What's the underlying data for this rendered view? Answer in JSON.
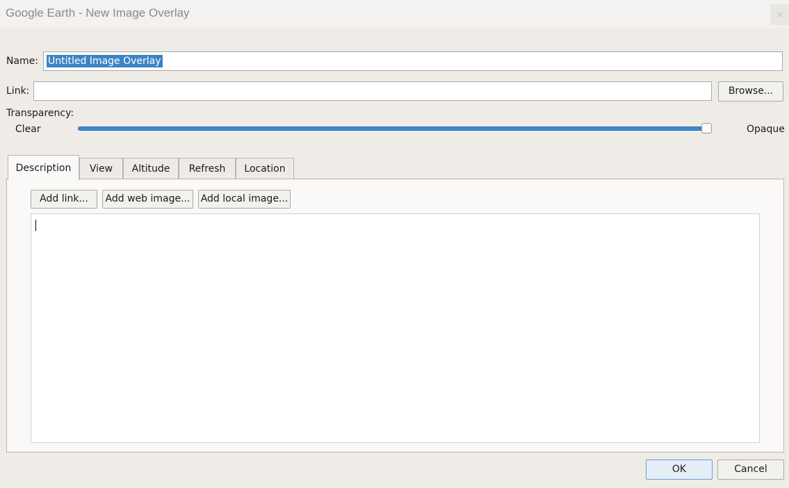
{
  "window": {
    "title": "Google Earth - New Image Overlay",
    "close_glyph": "×"
  },
  "form": {
    "name_label": "Name:",
    "name_value": "Untitled Image Overlay",
    "link_label": "Link:",
    "link_value": "",
    "browse_label": "Browse...",
    "transparency_label": "Transparency:",
    "clear_label": "Clear",
    "opaque_label": "Opaque",
    "transparency_level": 1.0
  },
  "tabs": [
    {
      "label": "Description",
      "active": true
    },
    {
      "label": "View",
      "active": false
    },
    {
      "label": "Altitude",
      "active": false
    },
    {
      "label": "Refresh",
      "active": false
    },
    {
      "label": "Location",
      "active": false
    }
  ],
  "description": {
    "add_link_label": "Add link...",
    "add_web_image_label": "Add web image...",
    "add_local_image_label": "Add local image...",
    "text": ""
  },
  "footer": {
    "ok_label": "OK",
    "cancel_label": "Cancel"
  },
  "colors": {
    "accent": "#3b84c4",
    "slider": "#3a8ad0"
  }
}
